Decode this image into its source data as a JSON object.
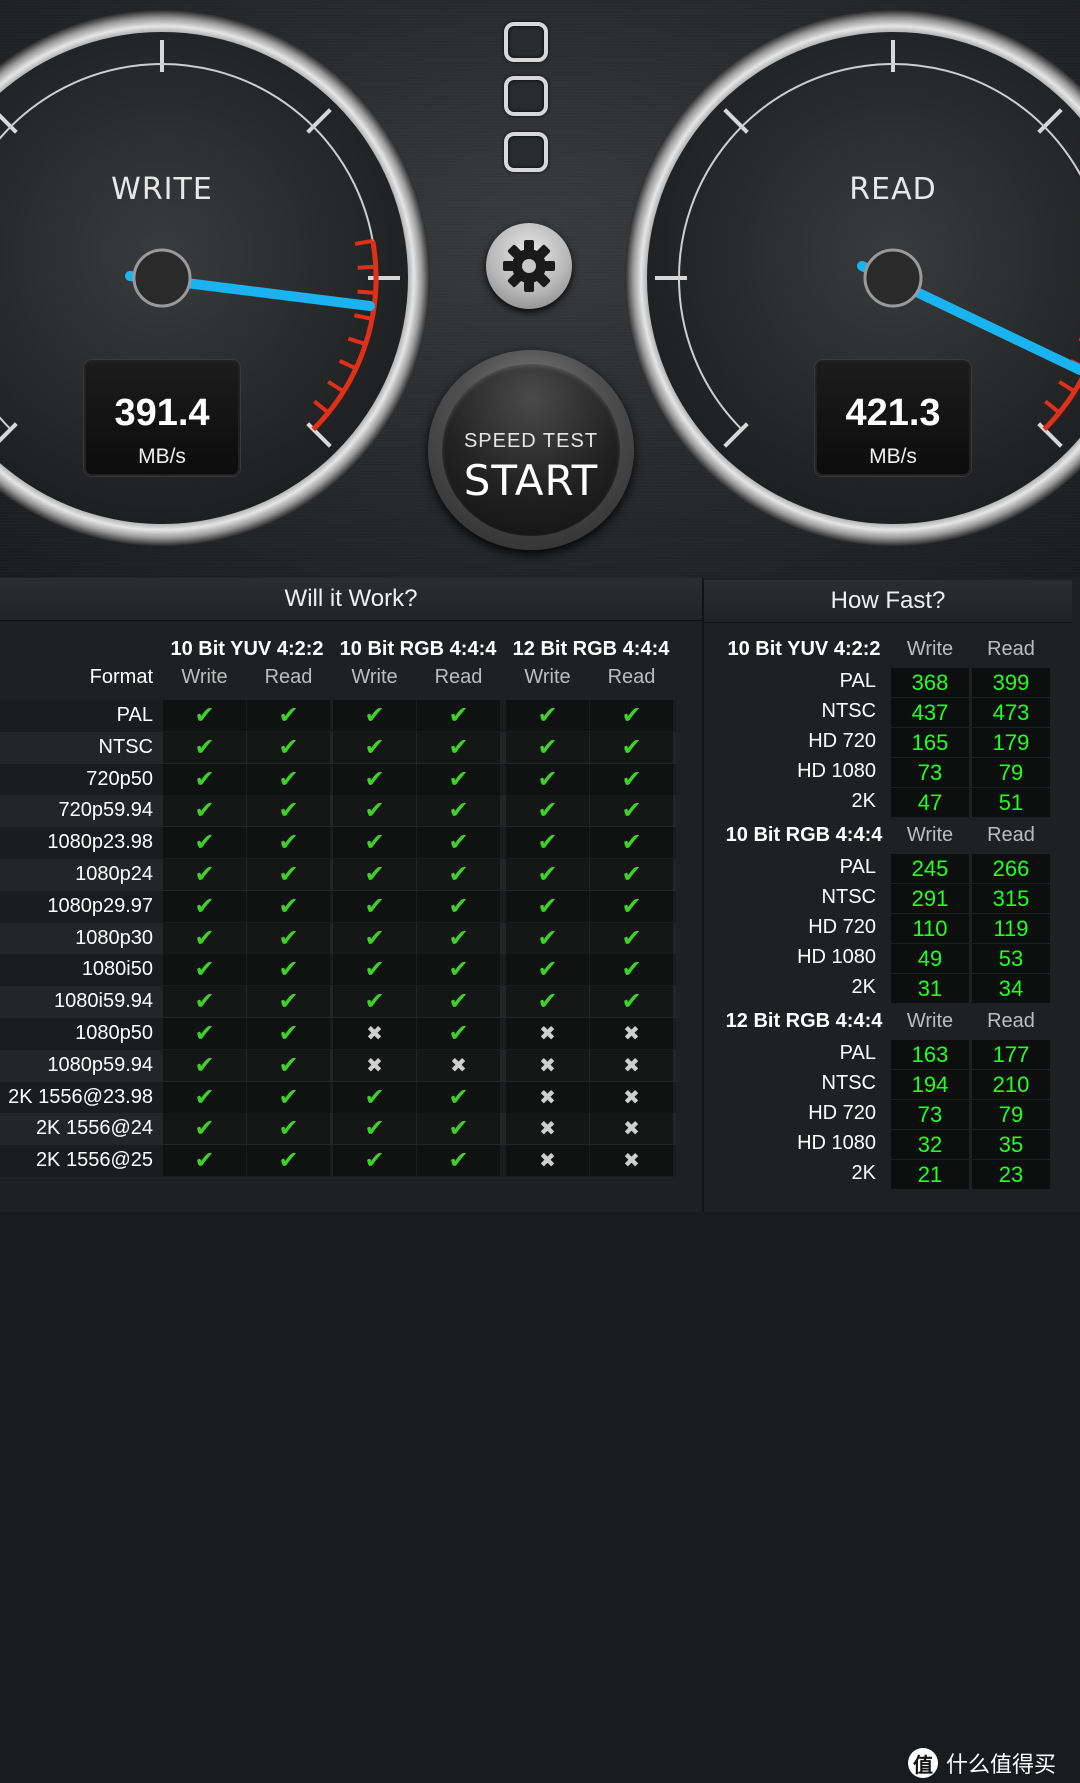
{
  "gauges": {
    "write": {
      "label": "WRITE",
      "value": "391.4",
      "unit": "MB/s",
      "needle_fraction": 0.78
    },
    "read": {
      "label": "READ",
      "value": "421.3",
      "unit": "MB/s",
      "needle_fraction": 0.84
    }
  },
  "start_button": {
    "sub": "SPEED TEST",
    "main": "START"
  },
  "settings_button": {
    "icon": "gear-icon"
  },
  "colors": {
    "needle": "#19b4f0",
    "check": "#3fd12a",
    "fast_value": "#22ff22",
    "redline": "#e0301a"
  },
  "will_it_work": {
    "title": "Will it Work?",
    "format_label": "Format",
    "groups": [
      "10 Bit YUV 4:2:2",
      "10 Bit RGB 4:4:4",
      "12 Bit RGB 4:4:4"
    ],
    "subcolumns": [
      "Write",
      "Read",
      "Write",
      "Read",
      "Write",
      "Read"
    ],
    "rows": [
      {
        "format": "PAL",
        "cells": [
          true,
          true,
          true,
          true,
          true,
          true
        ]
      },
      {
        "format": "NTSC",
        "cells": [
          true,
          true,
          true,
          true,
          true,
          true
        ]
      },
      {
        "format": "720p50",
        "cells": [
          true,
          true,
          true,
          true,
          true,
          true
        ]
      },
      {
        "format": "720p59.94",
        "cells": [
          true,
          true,
          true,
          true,
          true,
          true
        ]
      },
      {
        "format": "1080p23.98",
        "cells": [
          true,
          true,
          true,
          true,
          true,
          true
        ]
      },
      {
        "format": "1080p24",
        "cells": [
          true,
          true,
          true,
          true,
          true,
          true
        ]
      },
      {
        "format": "1080p29.97",
        "cells": [
          true,
          true,
          true,
          true,
          true,
          true
        ]
      },
      {
        "format": "1080p30",
        "cells": [
          true,
          true,
          true,
          true,
          true,
          true
        ]
      },
      {
        "format": "1080i50",
        "cells": [
          true,
          true,
          true,
          true,
          true,
          true
        ]
      },
      {
        "format": "1080i59.94",
        "cells": [
          true,
          true,
          true,
          true,
          true,
          true
        ]
      },
      {
        "format": "1080p50",
        "cells": [
          true,
          true,
          false,
          true,
          false,
          false
        ]
      },
      {
        "format": "1080p59.94",
        "cells": [
          true,
          true,
          false,
          false,
          false,
          false
        ]
      },
      {
        "format": "2K 1556@23.98",
        "cells": [
          true,
          true,
          true,
          true,
          false,
          false
        ]
      },
      {
        "format": "2K 1556@24",
        "cells": [
          true,
          true,
          true,
          true,
          false,
          false
        ]
      },
      {
        "format": "2K 1556@25",
        "cells": [
          true,
          true,
          true,
          true,
          false,
          false
        ]
      }
    ]
  },
  "how_fast": {
    "title": "How Fast?",
    "sections": [
      {
        "name": "10 Bit YUV 4:2:2",
        "write_label": "Write",
        "read_label": "Read",
        "rows": [
          {
            "format": "PAL",
            "write": "368",
            "read": "399"
          },
          {
            "format": "NTSC",
            "write": "437",
            "read": "473"
          },
          {
            "format": "HD 720",
            "write": "165",
            "read": "179"
          },
          {
            "format": "HD 1080",
            "write": "73",
            "read": "79"
          },
          {
            "format": "2K",
            "write": "47",
            "read": "51"
          }
        ]
      },
      {
        "name": "10 Bit RGB 4:4:4",
        "write_label": "Write",
        "read_label": "Read",
        "rows": [
          {
            "format": "PAL",
            "write": "245",
            "read": "266"
          },
          {
            "format": "NTSC",
            "write": "291",
            "read": "315"
          },
          {
            "format": "HD 720",
            "write": "110",
            "read": "119"
          },
          {
            "format": "HD 1080",
            "write": "49",
            "read": "53"
          },
          {
            "format": "2K",
            "write": "31",
            "read": "34"
          }
        ]
      },
      {
        "name": "12 Bit RGB 4:4:4",
        "write_label": "Write",
        "read_label": "Read",
        "rows": [
          {
            "format": "PAL",
            "write": "163",
            "read": "177"
          },
          {
            "format": "NTSC",
            "write": "194",
            "read": "210"
          },
          {
            "format": "HD 720",
            "write": "73",
            "read": "79"
          },
          {
            "format": "HD 1080",
            "write": "32",
            "read": "35"
          },
          {
            "format": "2K",
            "write": "21",
            "read": "23"
          }
        ]
      }
    ]
  },
  "watermark": {
    "icon_text": "值",
    "text": "什么值得买"
  }
}
